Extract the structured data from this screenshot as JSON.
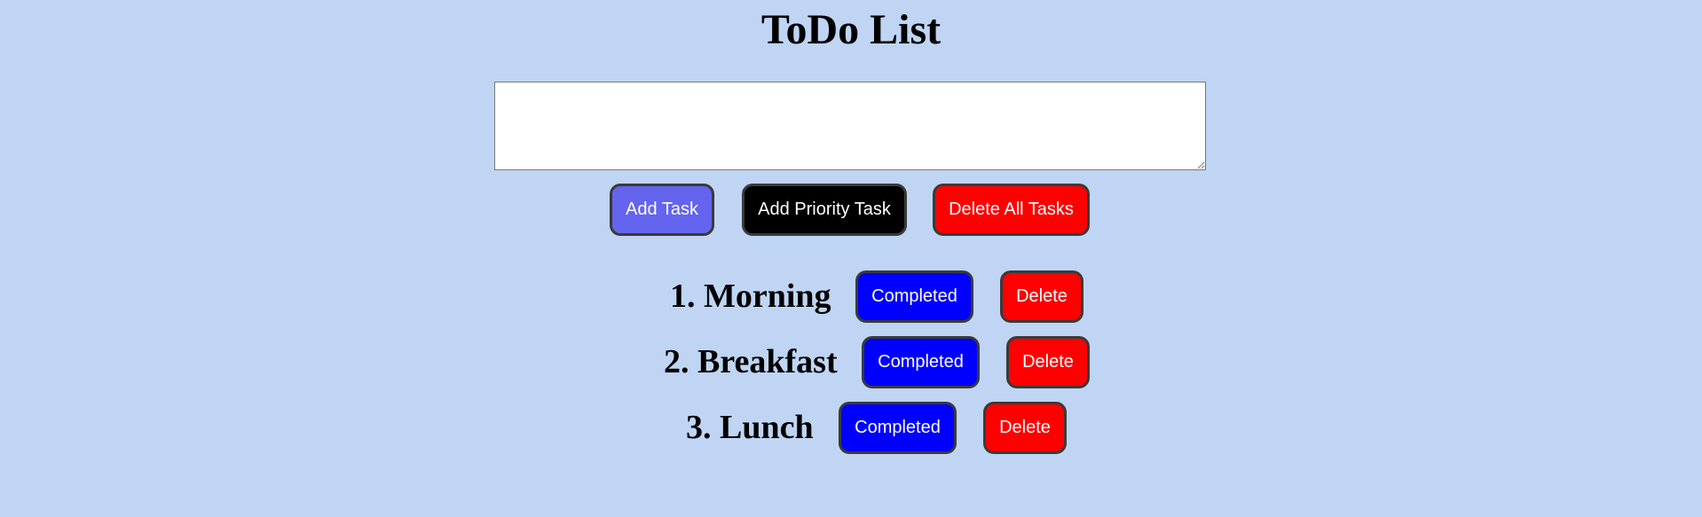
{
  "page": {
    "title": "ToDo List"
  },
  "input": {
    "value": ""
  },
  "controls": {
    "add_task": "Add Task",
    "add_priority_task": "Add Priority Task",
    "delete_all_tasks": "Delete All Tasks"
  },
  "tasks": [
    {
      "label": "1. Morning",
      "completed": "Completed",
      "delete": "Delete"
    },
    {
      "label": "2. Breakfast",
      "completed": "Completed",
      "delete": "Delete"
    },
    {
      "label": "3. Lunch",
      "completed": "Completed",
      "delete": "Delete"
    }
  ],
  "colors": {
    "background": "#bfd5f3",
    "add_task": "#6464ee",
    "add_priority_task": "#000000",
    "delete": "#ff0000",
    "completed": "#0000ff"
  }
}
